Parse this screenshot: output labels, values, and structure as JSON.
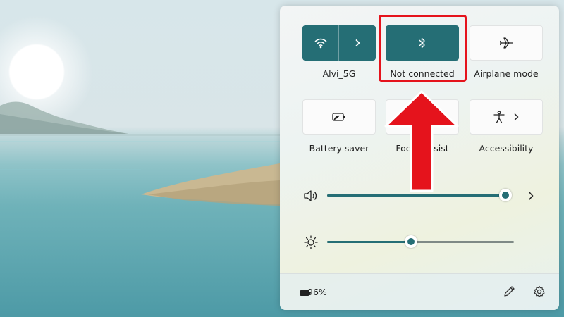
{
  "quick_settings": {
    "tiles": [
      {
        "label": "Alvi_5G",
        "icon": "wifi-icon",
        "state": "on",
        "has_chevron": true
      },
      {
        "label": "Not connected",
        "icon": "bluetooth-icon",
        "state": "on"
      },
      {
        "label": "Airplane mode",
        "icon": "airplane-icon",
        "state": "off"
      },
      {
        "label": "Battery saver",
        "icon": "battery-saver-icon",
        "state": "off"
      },
      {
        "label": "Focus assist",
        "icon": "focus-assist-icon",
        "state": "off"
      },
      {
        "label": "Accessibility",
        "icon": "accessibility-icon",
        "state": "off",
        "has_chevron": true
      }
    ],
    "volume": {
      "icon": "speaker-icon",
      "level": 0.99,
      "has_chevron": true
    },
    "brightness": {
      "icon": "brightness-icon",
      "level": 0.45
    }
  },
  "footer": {
    "battery_icon": "battery-icon",
    "battery_percent": "96%",
    "edit_icon": "pencil-icon",
    "settings_icon": "gear-icon"
  },
  "colors": {
    "accent": "#256e75",
    "annotation": "#e5131c"
  },
  "annotation": {
    "highlight_target": "bluetooth tile",
    "arrow_icon": "up-arrow-icon"
  }
}
